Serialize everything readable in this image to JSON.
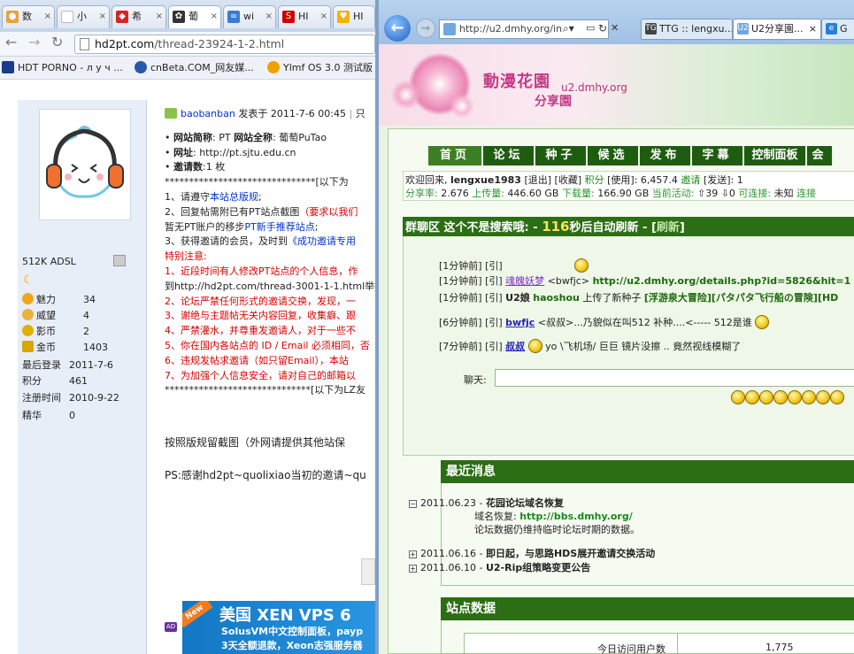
{
  "chrome": {
    "tabs": [
      {
        "fav": "🐱",
        "label": "数"
      },
      {
        "fav": "",
        "label": "小"
      },
      {
        "fav": "",
        "label": "希"
      },
      {
        "fav": "",
        "label": "葡"
      },
      {
        "fav": "",
        "label": "wi"
      },
      {
        "fav": "",
        "label": "HI"
      },
      {
        "fav": "",
        "label": "HI"
      }
    ],
    "url_domain": "hd2pt.com",
    "url_path": "/thread-23924-1-2.html",
    "bookmarks": [
      "HDT PORNO - л у ч ...",
      "cnBeta.COM_网友媒...",
      "Ylmf OS 3.0 测试版"
    ]
  },
  "forum": {
    "username": "512K ADSL",
    "stats": [
      {
        "key": "魅力",
        "val": "34"
      },
      {
        "key": "威望",
        "val": "4"
      },
      {
        "key": "影币",
        "val": "2"
      },
      {
        "key": "金币",
        "val": "1403"
      },
      {
        "key": "最后登录",
        "val": "2011-7-6"
      },
      {
        "key": "积分",
        "val": "461"
      },
      {
        "key": "注册时间",
        "val": "2010-9-22"
      },
      {
        "key": "精华",
        "val": "0"
      }
    ],
    "post_author": "baobanban",
    "post_time": "发表于 2011-7-6 00:45",
    "post_more": "只",
    "site_short_label": "网站简称",
    "site_short": ": PT",
    "site_full_label": "网站全称",
    "site_full": ": 葡萄PuTao",
    "site_url_label": "网址",
    "site_url": ": http://pt.sjtu.edu.cn",
    "invites_label": "邀请数",
    "invites": ":1 枚",
    "sep1": "*******************************[以下为",
    "rule1_pre": "1、请遵守",
    "rule1_link": "本站总版规",
    "rule1_post": ";",
    "rule2_pre": "2、回复帖需附已有PT站点截图",
    "rule2_red": "（要求以我们",
    "rule2b_pre": "暂无PT账户的移步",
    "rule2b_link": "PT新手推荐站点",
    "rule2b_post": ";",
    "rule3_pre": "3、获得邀请的会员，及时到",
    "rule3_link": "《成功邀请专用",
    "notice": "特别注意:",
    "r1": "1、近段时间有人修改PT站点的个人信息，作",
    "r1b": "到http://hd2pt.com/thread-3001-1-1.html举报",
    "r2": "2、论坛严禁任何形式的邀请交换，发现，一",
    "r3": "3、谢绝与主题帖无关内容回复，收集癖、跟",
    "r4": "4、严禁灌水，并尊重发邀请人，对于一些不",
    "r5": "5、你在国内各站点的 ID / Email 必须相同，否",
    "r6": "6、违规发帖求邀请（如只留Email），本站",
    "r7": "7、为加强个人信息安全，请对自己的邮箱以",
    "sep2": "******************************[以下为LZ友",
    "para1": "按照版规留截图（外网请提供其他站保",
    "para2": "PS:感谢hd2pt~quolixiao当初的邀请~qu",
    "ad_badge": "New",
    "ad_tag": "AD",
    "ad_title": "美国 XEN VPS 6",
    "ad_line2": "SolusVM中文控制面板，payp",
    "ad_line3": "3天全额退款，Xeon志强服务器"
  },
  "ie": {
    "url": "http://u2.dmhy.org/in",
    "tabs": [
      {
        "fav": "TG",
        "label": "TTG :: lengxu..."
      },
      {
        "fav": "U2",
        "label": "U2分享園..."
      },
      {
        "fav": "e",
        "label": "G"
      }
    ]
  },
  "u2": {
    "logo_text": "動漫花園",
    "logo_domain": "u2.dmhy.org",
    "logo_sub": "分享園",
    "nav": [
      "首页",
      "论坛",
      "种子",
      "候选",
      "发布",
      "字幕",
      "控制面板",
      "会"
    ],
    "welcome_prefix": "欢迎回来, ",
    "welcome_user": "lengxue1983",
    "welcome_logout": " [退出]",
    "welcome_fav": " [收藏]",
    "welcome_points_label": " 积分",
    "welcome_points": " [使用]: 6,457.4 ",
    "welcome_invite_label": "邀请",
    "welcome_invite": " [发送]: 1",
    "ratio_label": "分享率:",
    "ratio": "  2.676 ",
    "up_label": "上传量:",
    "up": "  446.60 GB ",
    "down_label": "下载量:",
    "down": "  166.90 GB ",
    "active_label": "当前活动:",
    "active": " ⇧39 ⇩0 ",
    "conn_label": "可连接:",
    "conn": " 未知 ",
    "conn2": "连接",
    "chat_title": "群聊区 这个不是搜索哦: - ",
    "chat_num": "116",
    "chat_auto": "秒后自动刷新",
    "chat_dash": " - [",
    "chat_refresh": "刷新",
    "chat_close": "]",
    "chat": [
      {
        "time": "[1分钟前] [引]",
        "user": "",
        "text": ""
      },
      {
        "time": "[1分钟前] [引]",
        "user": "魂魄妖梦",
        "text": " <bwfjc> ",
        "link": "http://u2.dmhy.org/details.php?id=5826&hit=1"
      },
      {
        "time": "[1分钟前] [引]",
        "user": "U2娘",
        "user2": "haoshou",
        "text": " 上传了新种子 ",
        "link": "[浮游泉大冒险][パタパタ飞行船の冒険][HD"
      },
      {
        "time": "[6分钟前] [引]",
        "user": "bwfjc",
        "text": " <叔叔>...乃貌似在叫512 补种....<----- 512是谁 "
      },
      {
        "time": "[7分钟前] [引]",
        "user": "叔叔",
        "text": " yo \\飞机场/ 巨巨 镜片没擦 .. 竟然视线模糊了"
      }
    ],
    "chat_label": "聊天:",
    "news_title": "最近消息",
    "news": [
      {
        "date": "2011.06.23 - ",
        "title": "花园论坛域名恢复",
        "body1": "域名恢复: ",
        "body_link": "http://bbs.dmhy.org/",
        "body2": "论坛数据仍维持临时论坛时期的数据。"
      },
      {
        "date": "2011.06.16 - ",
        "title": "即日起，与思路HDS展开邀请交换活动"
      },
      {
        "date": "2011.06.10 - ",
        "title": "U2-Rip组策略变更公告"
      }
    ],
    "stats_title": "站点数据",
    "stats_row_label": "今日访问用户数",
    "stats_row_val": "1,775"
  }
}
